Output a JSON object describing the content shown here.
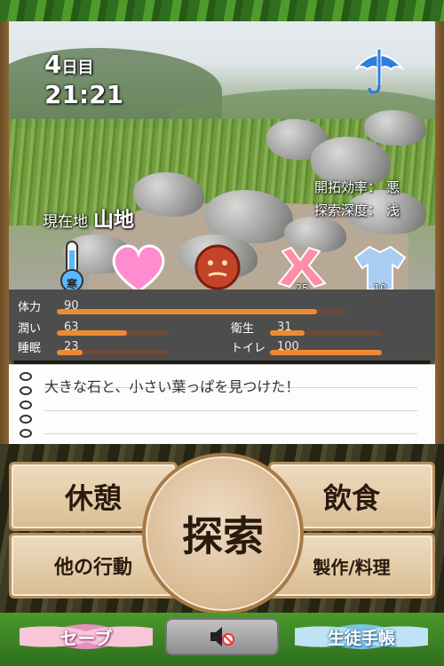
{
  "hud": {
    "day_number": "4",
    "day_unit": "日目",
    "time": "21:21",
    "weather_icon": "umbrella-icon",
    "location_label": "現在地",
    "location_value": "山地",
    "efficiency_label": "開拓効率：",
    "efficiency_value": "悪",
    "depth_label": "探索深度：",
    "depth_value": "浅"
  },
  "status_icons": {
    "thermometer": {
      "icon": "thermometer-icon",
      "badge": "寒"
    },
    "heart": {
      "icon": "heart-icon"
    },
    "mood": {
      "icon": "face-icon"
    },
    "tool": {
      "icon": "tool-icon",
      "value": "25"
    },
    "clothing": {
      "icon": "shirt-icon",
      "value": "10"
    }
  },
  "stats": [
    {
      "name": "体力",
      "value": "90",
      "level": 0.9
    },
    {
      "name": "潤い",
      "value": "63",
      "level": 0.63
    },
    {
      "name": "睡眠",
      "value": "23",
      "level": 0.23
    },
    {
      "name": "衛生",
      "value": "31",
      "level": 0.31
    },
    {
      "name": "トイレ",
      "value": "100",
      "level": 1.0
    }
  ],
  "message": {
    "text": "大きな石と、小さい葉っぱを見つけた！"
  },
  "actions": {
    "rest": "休憩",
    "eat": "飲食",
    "explore": "探索",
    "other": "他の行動",
    "craft": "製作/料理"
  },
  "bottom": {
    "save": "セーブ",
    "notebook": "生徒手帳",
    "mute_icon": "speaker-mute-icon"
  },
  "colors": {
    "bar_fill": "#ee8a36",
    "bar_track": "#6a4a3a",
    "panel": "#4d4d4d",
    "button": "#e6cfaa"
  }
}
